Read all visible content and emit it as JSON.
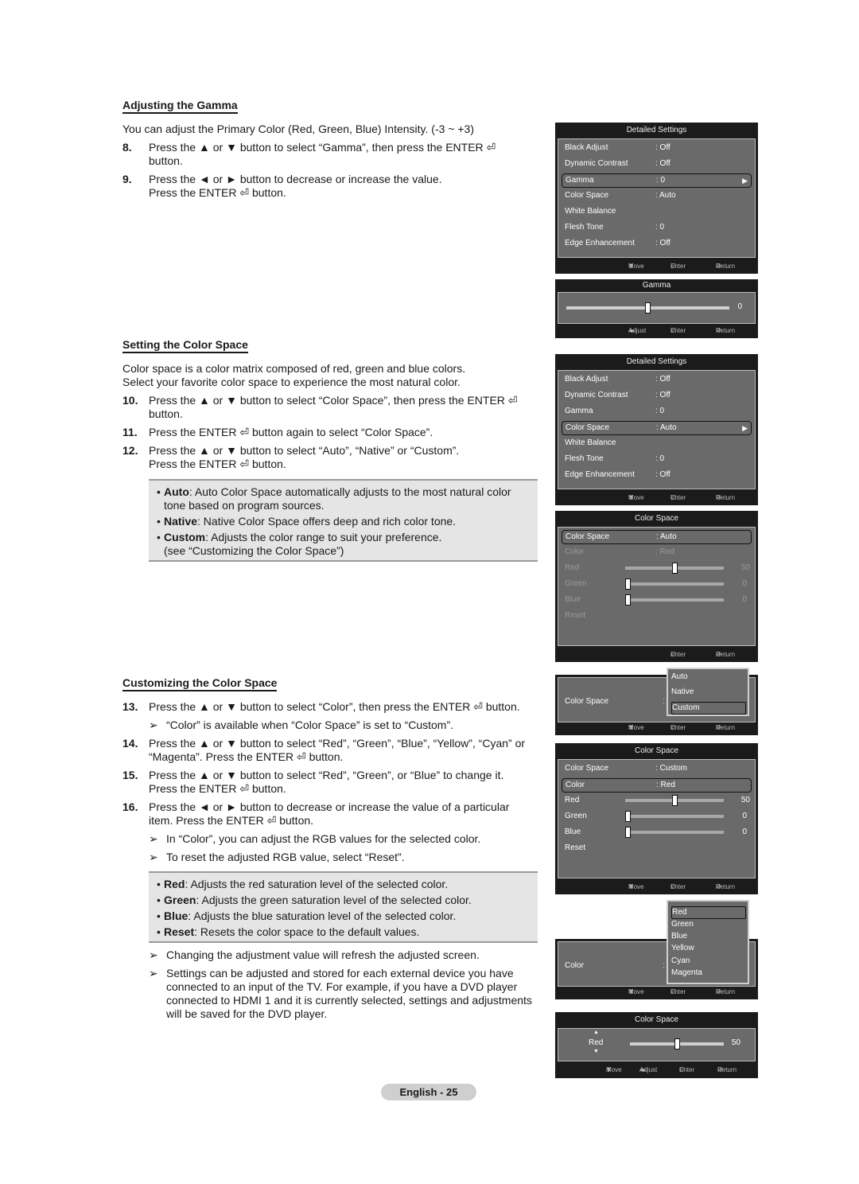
{
  "sections": {
    "gamma": {
      "heading": "Adjusting the Gamma",
      "intro": "You can adjust the Primary Color (Red, Green, Blue) Intensity. (-3 ~ +3)",
      "steps": [
        {
          "num": "8.",
          "line1": "Press the ▲ or ▼ button to select “Gamma”, then press the ENTER ⏎",
          "line2": "button."
        },
        {
          "num": "9.",
          "line1": "Press the ◄ or ► button to decrease or increase the value.",
          "line2": "Press the ENTER ⏎ button."
        }
      ]
    },
    "color_space": {
      "heading": "Setting the Color Space",
      "intro1": "Color space is a color matrix composed of red, green and blue colors.",
      "intro2": "Select your favorite color space to experience the most natural color.",
      "steps": [
        {
          "num": "10.",
          "line1": "Press the ▲ or ▼ button to select “Color Space”, then press the ENTER ⏎",
          "line2": "button."
        },
        {
          "num": "11.",
          "line1": "Press the ENTER ⏎ button again to select “Color Space”.",
          "line2": ""
        },
        {
          "num": "12.",
          "line1": "Press the ▲ or ▼ button to select “Auto”, “Native” or “Custom”.",
          "line2": "Press the ENTER ⏎ button."
        }
      ],
      "bullets": [
        {
          "term": "Auto",
          "line1": ": Auto Color Space automatically adjusts to the most natural color",
          "line2": "tone based on program sources."
        },
        {
          "term": "Native",
          "line1": ": Native Color Space offers deep and rich color tone.",
          "line2": ""
        },
        {
          "term": "Custom",
          "line1": ": Adjusts the color range to suit your preference.",
          "line2": "(see “Customizing the Color Space”)"
        }
      ]
    },
    "customizing": {
      "heading": "Customizing the Color Space",
      "steps": [
        {
          "num": "13.",
          "line1": "Press the ▲ or ▼ button to select “Color”, then press the ENTER ⏎ button.",
          "line2": ""
        },
        {
          "num": "14.",
          "line1": "Press the ▲ or ▼ button to select “Red”, “Green”, “Blue”, “Yellow”, “Cyan” or",
          "line2": "“Magenta”. Press the ENTER ⏎ button."
        },
        {
          "num": "15.",
          "line1": "Press the ▲ or ▼ button to select “Red”, “Green”, or “Blue” to change it.",
          "line2": "Press the ENTER ⏎ button."
        },
        {
          "num": "16.",
          "line1": "Press the ◄ or ► button to decrease or increase the value of a particular",
          "line2": "item. Press the ENTER ⏎ button."
        }
      ],
      "note_13": "“Color” is available when “Color Space” is set to “Custom”.",
      "notes_16": [
        "In “Color”, you can adjust the RGB values for the selected color.",
        "To reset the adjusted RGB value, select “Reset”."
      ],
      "bullets": [
        {
          "term": "Red",
          "text": ": Adjusts the red saturation level of the selected color."
        },
        {
          "term": "Green",
          "text": ": Adjusts the green saturation level of the selected color."
        },
        {
          "term": "Blue",
          "text": ": Adjusts the blue saturation level of the selected color."
        },
        {
          "term": "Reset",
          "text": ": Resets the color space to the default values."
        }
      ],
      "final_notes": [
        {
          "lines": [
            "Changing the adjustment value will refresh the adjusted screen."
          ]
        },
        {
          "lines": [
            "Settings can be adjusted and stored for each external device you have",
            "connected to an input of the TV. For example, if you have a DVD player",
            "connected to HDMI 1 and it is currently selected, settings and adjustments",
            "will be saved for the DVD player."
          ]
        }
      ]
    }
  },
  "osd": {
    "footer": {
      "move": "Move",
      "enter": "Enter",
      "return": "Return",
      "adjust": "Adjust"
    },
    "detailed_1": {
      "title": "Detailed Settings",
      "rows": [
        {
          "label": "Black Adjust",
          "value": ": Off"
        },
        {
          "label": "Dynamic Contrast",
          "value": ": Off"
        },
        {
          "label": "Gamma",
          "value": ": 0",
          "selected": true
        },
        {
          "label": "Color Space",
          "value": ": Auto"
        },
        {
          "label": "White Balance",
          "value": ""
        },
        {
          "label": "Flesh Tone",
          "value": ": 0"
        },
        {
          "label": "Edge Enhancement",
          "value": ": Off"
        }
      ]
    },
    "gamma_adj": {
      "title": "Gamma",
      "value": "0",
      "position_fraction": 0.5
    },
    "detailed_2": {
      "title": "Detailed Settings",
      "rows": [
        {
          "label": "Black Adjust",
          "value": ": Off"
        },
        {
          "label": "Dynamic Contrast",
          "value": ": Off"
        },
        {
          "label": "Gamma",
          "value": ": 0"
        },
        {
          "label": "Color Space",
          "value": ": Auto",
          "selected": true
        },
        {
          "label": "White Balance",
          "value": ""
        },
        {
          "label": "Flesh Tone",
          "value": ": 0"
        },
        {
          "label": "Edge Enhancement",
          "value": ": Off"
        }
      ]
    },
    "color_space_auto": {
      "title": "Color Space",
      "color_space_label": "Color Space",
      "color_space_value": ": Auto",
      "color_label": "Color",
      "color_value": ": Red",
      "sliders": [
        {
          "label": "Red",
          "value": "50",
          "fraction": 0.5
        },
        {
          "label": "Green",
          "value": "0",
          "fraction": 0
        },
        {
          "label": "Blue",
          "value": "0",
          "fraction": 0
        }
      ],
      "reset_label": "Reset"
    },
    "color_space_dropdown": {
      "label": "Color Space",
      "options": [
        "Auto",
        "Native",
        "Custom"
      ],
      "selected": "Custom"
    },
    "color_space_custom": {
      "title": "Color Space",
      "color_space_label": "Color Space",
      "color_space_value": ": Custom",
      "color_label": "Color",
      "color_value": ": Red",
      "sliders": [
        {
          "label": "Red",
          "value": "50",
          "fraction": 0.5
        },
        {
          "label": "Green",
          "value": "0",
          "fraction": 0
        },
        {
          "label": "Blue",
          "value": "0",
          "fraction": 0
        }
      ],
      "reset_label": "Reset"
    },
    "color_dropdown": {
      "label": "Color",
      "options": [
        "Red",
        "Green",
        "Blue",
        "Yellow",
        "Cyan",
        "Magenta"
      ],
      "selected": "Red"
    },
    "red_adj": {
      "title": "Color Space",
      "label": "Red",
      "value": "50",
      "fraction": 0.5
    }
  },
  "page_number": "English - 25"
}
